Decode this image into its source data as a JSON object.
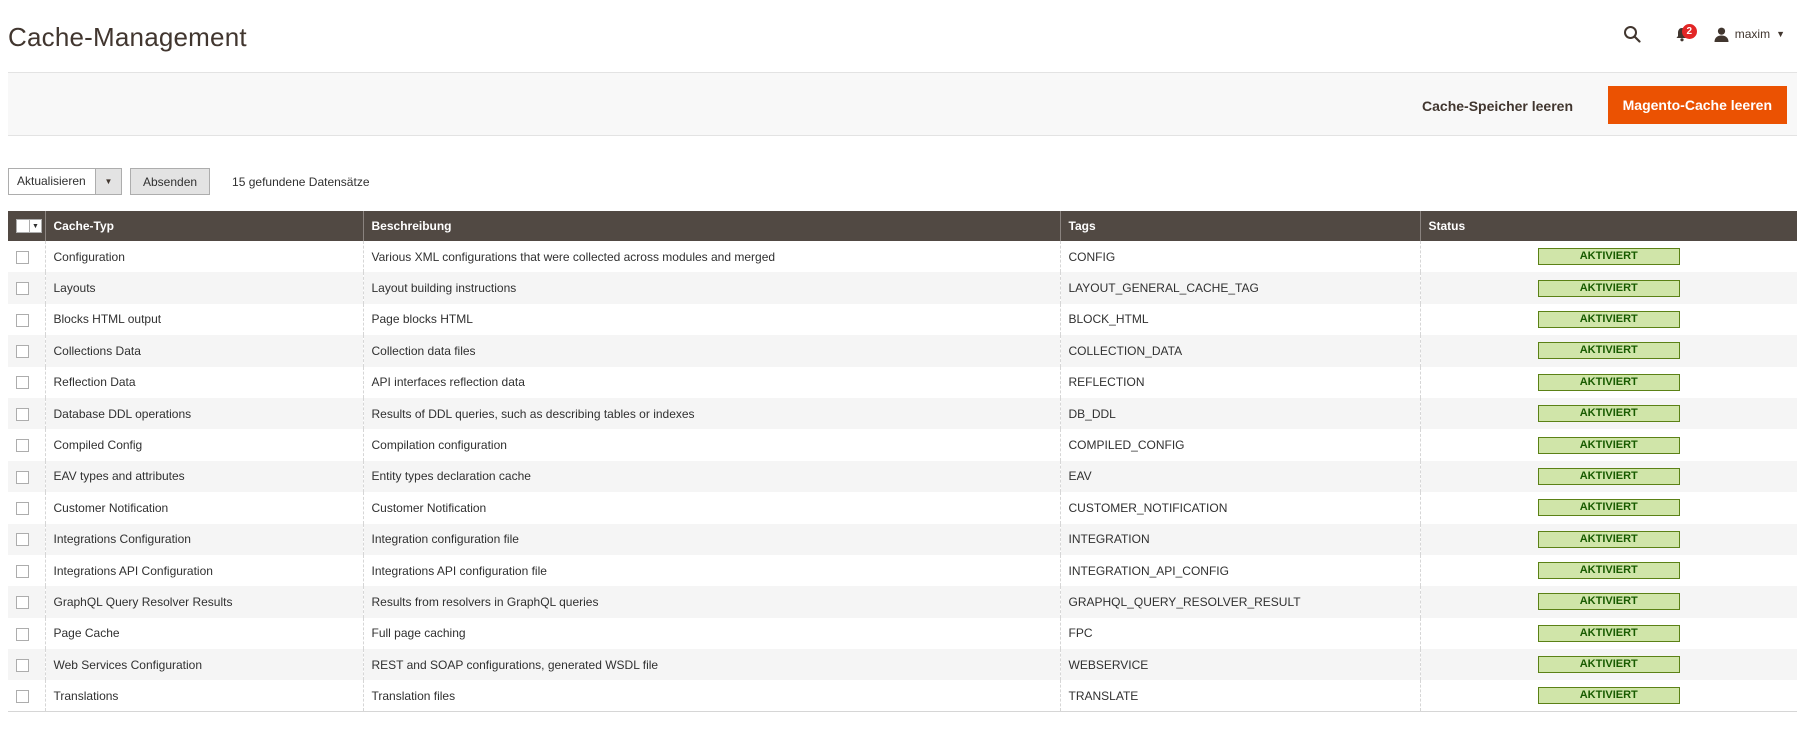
{
  "header": {
    "title": "Cache-Management",
    "notifications_count": "2",
    "user_name": "maxim",
    "icons": {
      "search": "search-icon",
      "bell": "bell-icon",
      "user": "user-icon",
      "caret": "chevron-down-icon"
    }
  },
  "actions": {
    "flush_storage_label": "Cache-Speicher leeren",
    "flush_magento_label": "Magento-Cache leeren",
    "accent_color": "#eb5202"
  },
  "toolbar": {
    "mass_action_selected": "Aktualisieren",
    "submit_label": "Absenden",
    "records_found": "15 gefundene Datensätze"
  },
  "grid": {
    "columns": {
      "cache_type": "Cache-Typ",
      "description": "Beschreibung",
      "tags": "Tags",
      "status": "Status"
    },
    "header_color": "#514943",
    "status_color": "#d0e5a9",
    "rows": [
      {
        "type": "Configuration",
        "description": "Various XML configurations that were collected across modules and merged",
        "tags": "CONFIG",
        "status": "AKTIVIERT"
      },
      {
        "type": "Layouts",
        "description": "Layout building instructions",
        "tags": "LAYOUT_GENERAL_CACHE_TAG",
        "status": "AKTIVIERT"
      },
      {
        "type": "Blocks HTML output",
        "description": "Page blocks HTML",
        "tags": "BLOCK_HTML",
        "status": "AKTIVIERT"
      },
      {
        "type": "Collections Data",
        "description": "Collection data files",
        "tags": "COLLECTION_DATA",
        "status": "AKTIVIERT"
      },
      {
        "type": "Reflection Data",
        "description": "API interfaces reflection data",
        "tags": "REFLECTION",
        "status": "AKTIVIERT"
      },
      {
        "type": "Database DDL operations",
        "description": "Results of DDL queries, such as describing tables or indexes",
        "tags": "DB_DDL",
        "status": "AKTIVIERT"
      },
      {
        "type": "Compiled Config",
        "description": "Compilation configuration",
        "tags": "COMPILED_CONFIG",
        "status": "AKTIVIERT"
      },
      {
        "type": "EAV types and attributes",
        "description": "Entity types declaration cache",
        "tags": "EAV",
        "status": "AKTIVIERT"
      },
      {
        "type": "Customer Notification",
        "description": "Customer Notification",
        "tags": "CUSTOMER_NOTIFICATION",
        "status": "AKTIVIERT"
      },
      {
        "type": "Integrations Configuration",
        "description": "Integration configuration file",
        "tags": "INTEGRATION",
        "status": "AKTIVIERT"
      },
      {
        "type": "Integrations API Configuration",
        "description": "Integrations API configuration file",
        "tags": "INTEGRATION_API_CONFIG",
        "status": "AKTIVIERT"
      },
      {
        "type": "GraphQL Query Resolver Results",
        "description": "Results from resolvers in GraphQL queries",
        "tags": "GRAPHQL_QUERY_RESOLVER_RESULT",
        "status": "AKTIVIERT"
      },
      {
        "type": "Page Cache",
        "description": "Full page caching",
        "tags": "FPC",
        "status": "AKTIVIERT"
      },
      {
        "type": "Web Services Configuration",
        "description": "REST and SOAP configurations, generated WSDL file",
        "tags": "WEBSERVICE",
        "status": "AKTIVIERT"
      },
      {
        "type": "Translations",
        "description": "Translation files",
        "tags": "TRANSLATE",
        "status": "AKTIVIERT"
      }
    ]
  }
}
